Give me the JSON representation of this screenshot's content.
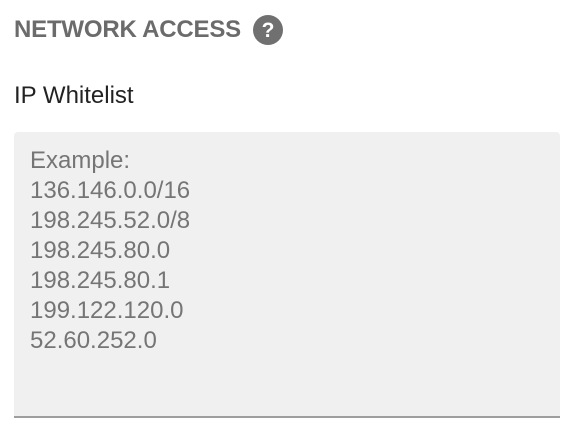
{
  "section": {
    "title": "NETWORK ACCESS",
    "help_icon": "question-mark-icon",
    "help_glyph": "?"
  },
  "ip_whitelist": {
    "label": "IP Whitelist",
    "value": "",
    "placeholder": "Example:\n136.146.0.0/16\n198.245.52.0/8\n198.245.80.0\n198.245.80.1\n199.122.120.0\n52.60.252.0"
  },
  "colors": {
    "title": "#6b6b6b",
    "help_icon_bg": "#707070",
    "textarea_bg": "#f0f0f0",
    "underline": "#9e9e9e"
  }
}
